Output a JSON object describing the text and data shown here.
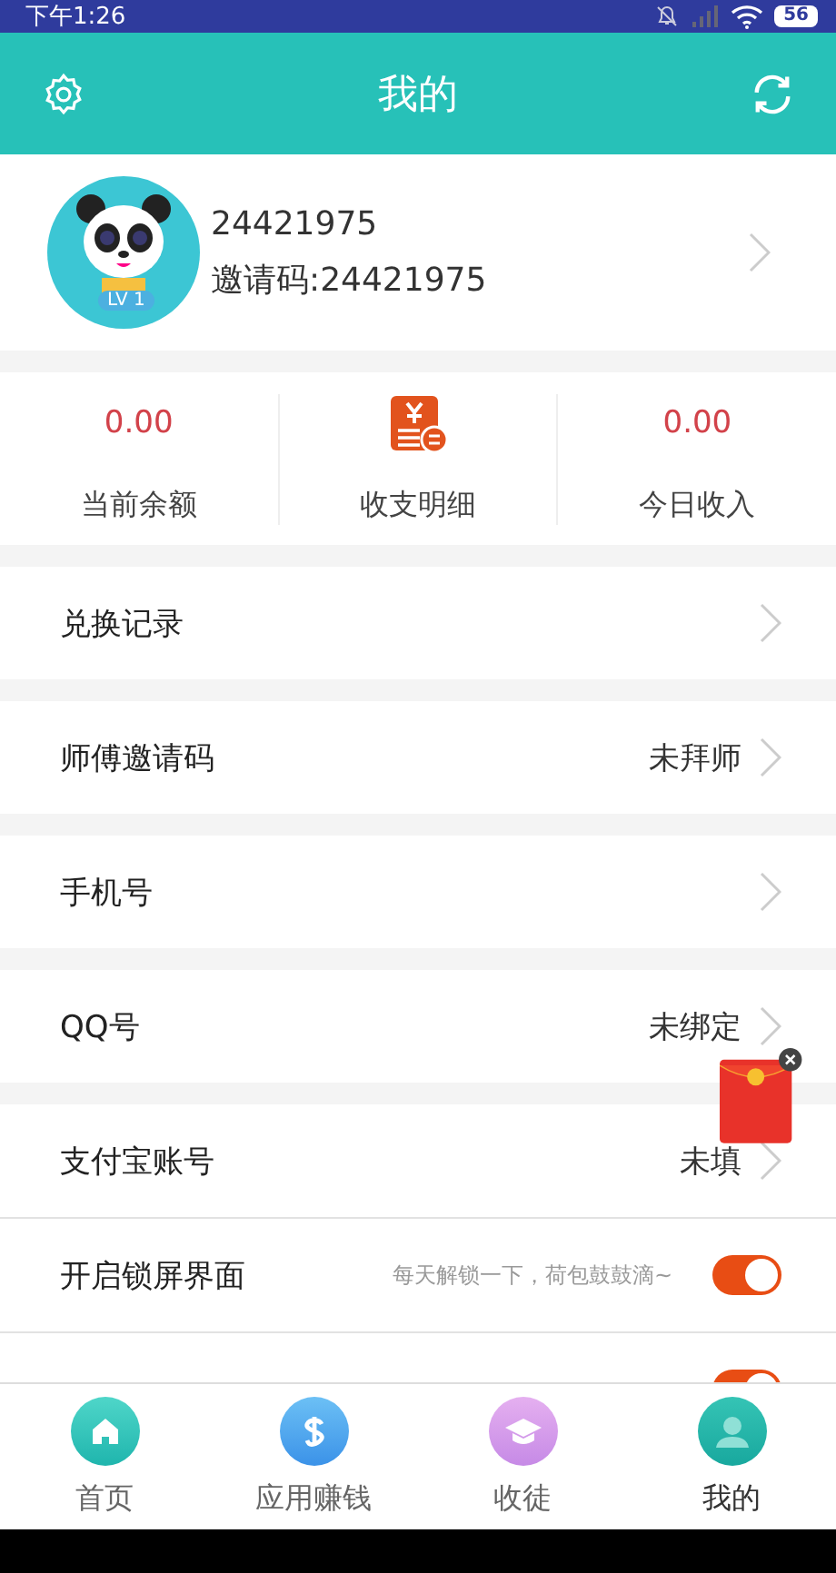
{
  "status_bar": {
    "time": "下午1:26",
    "battery": "56"
  },
  "header": {
    "title": "我的"
  },
  "profile": {
    "user_id": "24421975",
    "invite_code": "邀请码:24421975",
    "level": "LV 1"
  },
  "stats": [
    {
      "kind": "value",
      "value": "0.00",
      "label": "当前余额"
    },
    {
      "kind": "icon",
      "label": "收支明细"
    },
    {
      "kind": "value",
      "value": "0.00",
      "label": "今日收入"
    }
  ],
  "menu": [
    {
      "kind": "link",
      "label": "兑换记录",
      "gap": true
    },
    {
      "kind": "link",
      "label": "师傅邀请码",
      "value": "未拜师",
      "gap": true
    },
    {
      "kind": "link",
      "label": "手机号",
      "gap": true
    },
    {
      "kind": "link",
      "label": "QQ号",
      "value": "未绑定",
      "gap": true
    },
    {
      "kind": "link",
      "label": "支付宝账号",
      "value": "未填",
      "gap": true
    },
    {
      "kind": "toggle",
      "label": "开启锁屏界面",
      "hint": "每天解锁一下，荷包鼓鼓滴~",
      "on": true,
      "gap": false
    },
    {
      "kind": "toggle",
      "on": true,
      "gap": false
    }
  ],
  "tabs": [
    {
      "label": "首页",
      "selected": false
    },
    {
      "label": "应用赚钱",
      "selected": false
    },
    {
      "label": "收徒",
      "selected": false
    },
    {
      "label": "我的",
      "selected": true
    }
  ]
}
